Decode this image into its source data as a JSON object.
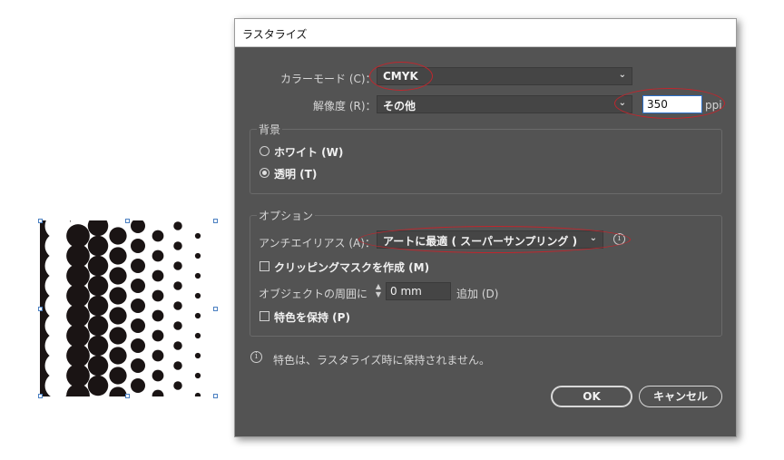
{
  "dialog": {
    "title": "ラスタライズ",
    "color_mode": {
      "label": "カラーモード (C)：",
      "value": "CMYK"
    },
    "resolution": {
      "label": "解像度 (R)：",
      "value": "その他",
      "ppi_value": "350",
      "ppi_unit": "ppi"
    },
    "background": {
      "title": "背景",
      "options": [
        {
          "label": "ホワイト (W)",
          "selected": false
        },
        {
          "label": "透明 (T)",
          "selected": true
        }
      ]
    },
    "options_group": {
      "title": "オプション",
      "antialias": {
        "label": "アンチエイリアス (A)：",
        "value": "アートに最適 ( スーパーサンプリング )"
      },
      "clipping_mask": {
        "label": "クリッピングマスクを作成 (M)",
        "checked": false
      },
      "around_object": {
        "label": "オブジェクトの周囲に",
        "value": "0 mm",
        "suffix": "追加 (D)"
      },
      "keep_spot": {
        "label": "特色を保持 (P)",
        "checked": false
      }
    },
    "info_message": "特色は、ラスタライズ時に保持されません。",
    "buttons": {
      "ok": "OK",
      "cancel": "キャンセル"
    }
  },
  "colors": {
    "dialog_bg": "#535353",
    "accent_ring": "#c0262d",
    "title_bg": "#ffffff"
  }
}
